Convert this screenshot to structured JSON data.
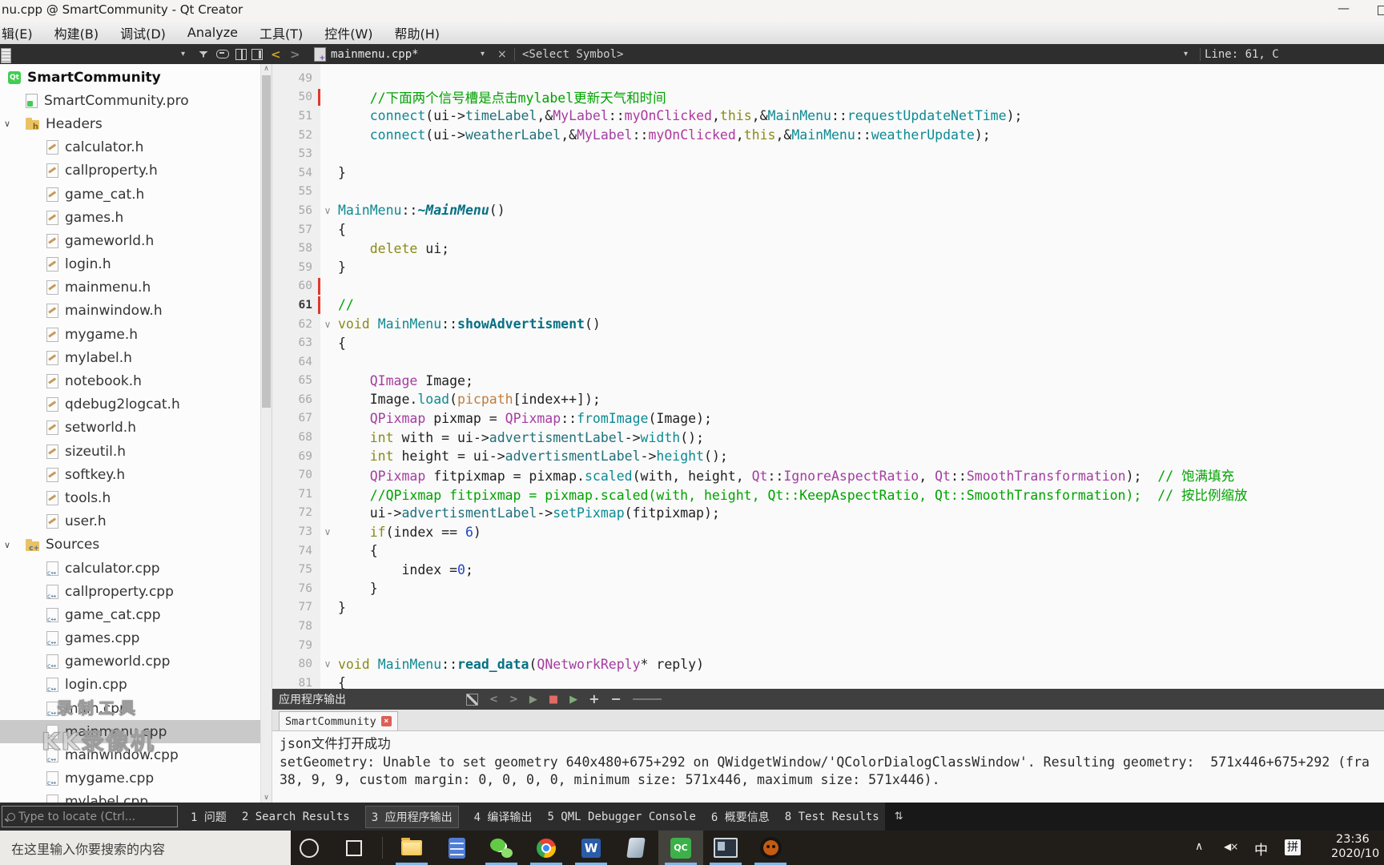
{
  "window": {
    "title": "nu.cpp @ SmartCommunity - Qt Creator"
  },
  "icons": {
    "minimize": "—",
    "chevron_down": "∨",
    "caret_down": "▾",
    "back_arrow": "<",
    "forward_arrow": ">",
    "close_x": "×",
    "tray_chevron": "∧",
    "volume_muted": "◀×",
    "updown": "⇅",
    "scroll_up": "∧",
    "scroll_down": "∨"
  },
  "menubar": {
    "items": [
      "辑(E)",
      "构建(B)",
      "调试(D)",
      "Analyze",
      "工具(T)",
      "控件(W)",
      "帮助(H)"
    ]
  },
  "navbar": {
    "open_file": "mainmenu.cpp*",
    "symbol": "<Select Symbol>",
    "cursor": "Line: 61, C"
  },
  "project_tree": {
    "watermark": {
      "line1": "录制工具",
      "line2": "KK录像机"
    },
    "items": [
      {
        "label": "SmartCommunity",
        "type": "project",
        "level": 0,
        "bold": true
      },
      {
        "label": "SmartCommunity.pro",
        "type": "profile",
        "level": 1
      },
      {
        "label": "Headers",
        "type": "folder-h",
        "level": 1,
        "expanded": true
      },
      {
        "label": "calculator.h",
        "type": "header",
        "level": 2
      },
      {
        "label": "callproperty.h",
        "type": "header",
        "level": 2
      },
      {
        "label": "game_cat.h",
        "type": "header",
        "level": 2
      },
      {
        "label": "games.h",
        "type": "header",
        "level": 2
      },
      {
        "label": "gameworld.h",
        "type": "header",
        "level": 2
      },
      {
        "label": "login.h",
        "type": "header",
        "level": 2
      },
      {
        "label": "mainmenu.h",
        "type": "header",
        "level": 2
      },
      {
        "label": "mainwindow.h",
        "type": "header",
        "level": 2
      },
      {
        "label": "mygame.h",
        "type": "header",
        "level": 2
      },
      {
        "label": "mylabel.h",
        "type": "header",
        "level": 2
      },
      {
        "label": "notebook.h",
        "type": "header",
        "level": 2
      },
      {
        "label": "qdebug2logcat.h",
        "type": "header",
        "level": 2
      },
      {
        "label": "setworld.h",
        "type": "header",
        "level": 2
      },
      {
        "label": "sizeutil.h",
        "type": "header",
        "level": 2
      },
      {
        "label": "softkey.h",
        "type": "header",
        "level": 2
      },
      {
        "label": "tools.h",
        "type": "header",
        "level": 2
      },
      {
        "label": "user.h",
        "type": "header",
        "level": 2
      },
      {
        "label": "Sources",
        "type": "folder-cpp",
        "level": 1,
        "expanded": true
      },
      {
        "label": "calculator.cpp",
        "type": "source",
        "level": 2
      },
      {
        "label": "callproperty.cpp",
        "type": "source",
        "level": 2
      },
      {
        "label": "game_cat.cpp",
        "type": "source",
        "level": 2
      },
      {
        "label": "games.cpp",
        "type": "source",
        "level": 2
      },
      {
        "label": "gameworld.cpp",
        "type": "source",
        "level": 2
      },
      {
        "label": "login.cpp",
        "type": "source",
        "level": 2
      },
      {
        "label": "main.cpp",
        "type": "source",
        "level": 2
      },
      {
        "label": "mainmenu.cpp",
        "type": "source",
        "level": 2,
        "selected": true
      },
      {
        "label": "mainwindow.cpp",
        "type": "source",
        "level": 2
      },
      {
        "label": "mygame.cpp",
        "type": "source",
        "level": 2
      },
      {
        "label": "mylabel.cpp",
        "type": "source",
        "level": 2
      }
    ]
  },
  "editor": {
    "lines": [
      {
        "n": 49,
        "tokens": []
      },
      {
        "n": 50,
        "mod": true,
        "tokens": [
          [
            "cm",
            "    //下面两个信号槽是点击mylabel更新天气和时间"
          ]
        ]
      },
      {
        "n": 51,
        "tokens": [
          [
            "pl",
            "    "
          ],
          [
            "fn",
            "connect"
          ],
          [
            "pl",
            "(ui->"
          ],
          [
            "mem",
            "timeLabel"
          ],
          [
            "pl",
            ",&"
          ],
          [
            "ty",
            "MyLabel"
          ],
          [
            "pl",
            "::"
          ],
          [
            "mfn",
            "myOnClicked"
          ],
          [
            "pl",
            ","
          ],
          [
            "kw",
            "this"
          ],
          [
            "pl",
            ",&"
          ],
          [
            "fn",
            "MainMenu"
          ],
          [
            "pl",
            "::"
          ],
          [
            "fn",
            "requestUpdateNetTime"
          ],
          [
            "pl",
            ");"
          ]
        ]
      },
      {
        "n": 52,
        "tokens": [
          [
            "pl",
            "    "
          ],
          [
            "fn",
            "connect"
          ],
          [
            "pl",
            "(ui->"
          ],
          [
            "mem",
            "weatherLabel"
          ],
          [
            "pl",
            ",&"
          ],
          [
            "ty",
            "MyLabel"
          ],
          [
            "pl",
            "::"
          ],
          [
            "mfn",
            "myOnClicked"
          ],
          [
            "pl",
            ","
          ],
          [
            "kw",
            "this"
          ],
          [
            "pl",
            ",&"
          ],
          [
            "fn",
            "MainMenu"
          ],
          [
            "pl",
            "::"
          ],
          [
            "fn",
            "weatherUpdate"
          ],
          [
            "pl",
            ");"
          ]
        ]
      },
      {
        "n": 53,
        "tokens": []
      },
      {
        "n": 54,
        "tokens": [
          [
            "pl",
            "}"
          ]
        ]
      },
      {
        "n": 55,
        "tokens": []
      },
      {
        "n": 56,
        "fold": true,
        "tokens": [
          [
            "fn",
            "MainMenu"
          ],
          [
            "pl",
            "::"
          ],
          [
            "virt",
            "~MainMenu"
          ],
          [
            "pl",
            "()"
          ]
        ]
      },
      {
        "n": 57,
        "tokens": [
          [
            "pl",
            "{"
          ]
        ]
      },
      {
        "n": 58,
        "tokens": [
          [
            "pl",
            "    "
          ],
          [
            "kw",
            "delete"
          ],
          [
            "pl",
            " ui;"
          ]
        ]
      },
      {
        "n": 59,
        "tokens": [
          [
            "pl",
            "}"
          ]
        ]
      },
      {
        "n": 60,
        "mod": true,
        "tokens": []
      },
      {
        "n": 61,
        "mod": true,
        "current": true,
        "tokens": [
          [
            "cm",
            "//"
          ]
        ]
      },
      {
        "n": 62,
        "fold": true,
        "tokens": [
          [
            "kw",
            "void"
          ],
          [
            "pl",
            " "
          ],
          [
            "fn",
            "MainMenu"
          ],
          [
            "pl",
            "::"
          ],
          [
            "fnd",
            "showAdvertisment"
          ],
          [
            "pl",
            "()"
          ]
        ]
      },
      {
        "n": 63,
        "tokens": [
          [
            "pl",
            "{"
          ]
        ]
      },
      {
        "n": 64,
        "tokens": []
      },
      {
        "n": 65,
        "tokens": [
          [
            "pl",
            "    "
          ],
          [
            "ty",
            "QImage"
          ],
          [
            "pl",
            " Image;"
          ]
        ]
      },
      {
        "n": 66,
        "tokens": [
          [
            "pl",
            "    Image."
          ],
          [
            "fn",
            "load"
          ],
          [
            "pl",
            "("
          ],
          [
            "fld",
            "picpath"
          ],
          [
            "pl",
            "[index++]);"
          ]
        ]
      },
      {
        "n": 67,
        "tokens": [
          [
            "pl",
            "    "
          ],
          [
            "ty",
            "QPixmap"
          ],
          [
            "pl",
            " pixmap = "
          ],
          [
            "ty",
            "QPixmap"
          ],
          [
            "pl",
            "::"
          ],
          [
            "fn",
            "fromImage"
          ],
          [
            "pl",
            "(Image);"
          ]
        ]
      },
      {
        "n": 68,
        "tokens": [
          [
            "pl",
            "    "
          ],
          [
            "kw",
            "int"
          ],
          [
            "pl",
            " with = ui->"
          ],
          [
            "mem",
            "advertismentLabel"
          ],
          [
            "pl",
            "->"
          ],
          [
            "fn",
            "width"
          ],
          [
            "pl",
            "();"
          ]
        ]
      },
      {
        "n": 69,
        "tokens": [
          [
            "pl",
            "    "
          ],
          [
            "kw",
            "int"
          ],
          [
            "pl",
            " height = ui->"
          ],
          [
            "mem",
            "advertismentLabel"
          ],
          [
            "pl",
            "->"
          ],
          [
            "fn",
            "height"
          ],
          [
            "pl",
            "();"
          ]
        ]
      },
      {
        "n": 70,
        "tokens": [
          [
            "pl",
            "    "
          ],
          [
            "ty",
            "QPixmap"
          ],
          [
            "pl",
            " fitpixmap = pixmap."
          ],
          [
            "fn",
            "scaled"
          ],
          [
            "pl",
            "(with, height, "
          ],
          [
            "ty",
            "Qt"
          ],
          [
            "pl",
            "::"
          ],
          [
            "ty",
            "IgnoreAspectRatio"
          ],
          [
            "pl",
            ", "
          ],
          [
            "ty",
            "Qt"
          ],
          [
            "pl",
            "::"
          ],
          [
            "ty",
            "SmoothTransformation"
          ],
          [
            "pl",
            ");  "
          ],
          [
            "cm",
            "// 饱满填充"
          ]
        ]
      },
      {
        "n": 71,
        "tokens": [
          [
            "pl",
            "    "
          ],
          [
            "cm",
            "//QPixmap fitpixmap = pixmap.scaled(with, height, Qt::KeepAspectRatio, Qt::SmoothTransformation);  // 按比例缩放"
          ]
        ]
      },
      {
        "n": 72,
        "tokens": [
          [
            "pl",
            "    ui->"
          ],
          [
            "mem",
            "advertismentLabel"
          ],
          [
            "pl",
            "->"
          ],
          [
            "fn",
            "setPixmap"
          ],
          [
            "pl",
            "(fitpixmap);"
          ]
        ]
      },
      {
        "n": 73,
        "fold": true,
        "tokens": [
          [
            "pl",
            "    "
          ],
          [
            "kw",
            "if"
          ],
          [
            "pl",
            "(index == "
          ],
          [
            "num",
            "6"
          ],
          [
            "pl",
            ")"
          ]
        ]
      },
      {
        "n": 74,
        "tokens": [
          [
            "pl",
            "    {"
          ]
        ]
      },
      {
        "n": 75,
        "tokens": [
          [
            "pl",
            "        index ="
          ],
          [
            "num",
            "0"
          ],
          [
            "pl",
            ";"
          ]
        ]
      },
      {
        "n": 76,
        "tokens": [
          [
            "pl",
            "    }"
          ]
        ]
      },
      {
        "n": 77,
        "tokens": [
          [
            "pl",
            "}"
          ]
        ]
      },
      {
        "n": 78,
        "tokens": []
      },
      {
        "n": 79,
        "tokens": []
      },
      {
        "n": 80,
        "fold": true,
        "tokens": [
          [
            "kw",
            "void"
          ],
          [
            "pl",
            " "
          ],
          [
            "fn",
            "MainMenu"
          ],
          [
            "pl",
            "::"
          ],
          [
            "fnd",
            "read_data"
          ],
          [
            "pl",
            "("
          ],
          [
            "ty",
            "QNetworkReply"
          ],
          [
            "pl",
            "* reply)"
          ]
        ]
      },
      {
        "n": 81,
        "tokens": [
          [
            "pl",
            "{"
          ]
        ]
      }
    ]
  },
  "output": {
    "pane_title": "应用程序输出",
    "tab": {
      "label": "SmartCommunity",
      "close": "×"
    },
    "toolbar": [
      {
        "name": "clear-output-icon",
        "cls": "clear",
        "glyph": ""
      },
      {
        "name": "back-icon",
        "cls": "dim",
        "glyph": "<"
      },
      {
        "name": "forward-icon",
        "cls": "dim",
        "glyph": ">"
      },
      {
        "name": "run-icon",
        "cls": "run",
        "glyph": "▶"
      },
      {
        "name": "stop-icon",
        "cls": "stop",
        "glyph": "■"
      },
      {
        "name": "run-debug-icon",
        "cls": "rundbg",
        "glyph": "▶"
      },
      {
        "name": "zoom-in-icon",
        "cls": "plus",
        "glyph": "+"
      },
      {
        "name": "zoom-out-icon",
        "cls": "plus",
        "glyph": "−"
      },
      {
        "name": "zoom-slider",
        "cls": "slider",
        "glyph": ""
      }
    ],
    "console": [
      "json文件打开成功",
      "setGeometry: Unable to set geometry 640x480+675+292 on QWidgetWindow/'QColorDialogClassWindow'. Resulting geometry:  571x446+675+292 (fra",
      "38, 9, 9, custom margin: 0, 0, 0, 0, minimum size: 571x446, maximum size: 571x446)."
    ]
  },
  "statusbar": {
    "locate_placeholder": "Type to locate (Ctrl...",
    "tabs": [
      {
        "label": "1 问题"
      },
      {
        "label": "2 Search Results"
      },
      {
        "label": "3 应用程序输出",
        "active": true
      },
      {
        "label": "4 编译输出"
      },
      {
        "label": "5 QML Debugger Console"
      },
      {
        "label": "6 概要信息"
      },
      {
        "label": "8 Test Results"
      }
    ]
  },
  "taskbar": {
    "search_placeholder": "在这里输入你要搜索的内容",
    "apps": [
      {
        "name": "file-explorer",
        "running": true
      },
      {
        "name": "calculator",
        "running": false
      },
      {
        "name": "wechat",
        "running": true
      },
      {
        "name": "chrome",
        "running": true
      },
      {
        "name": "word",
        "running": true
      },
      {
        "name": "glass-app",
        "running": false
      },
      {
        "name": "qt-creator",
        "running": true,
        "active": true
      },
      {
        "name": "monitor-app",
        "running": true
      },
      {
        "name": "recorder-app",
        "running": true
      }
    ],
    "tray": {
      "ime_lang": "中",
      "ime_mode": "拼"
    },
    "clock": {
      "time": "23:36",
      "date": "2020/10"
    }
  },
  "colors": {
    "accent_teal": "#0d8a93",
    "type_purple": "#a43ea0",
    "keyword_olive": "#8a8a1a",
    "comment_green": "#00a300",
    "field_tan": "#bd7d3e",
    "modified_red": "#e0392c",
    "stop_red": "#e06a64",
    "running_indicator_blue": "#7cb8e8",
    "qt_green": "#41cd52"
  }
}
